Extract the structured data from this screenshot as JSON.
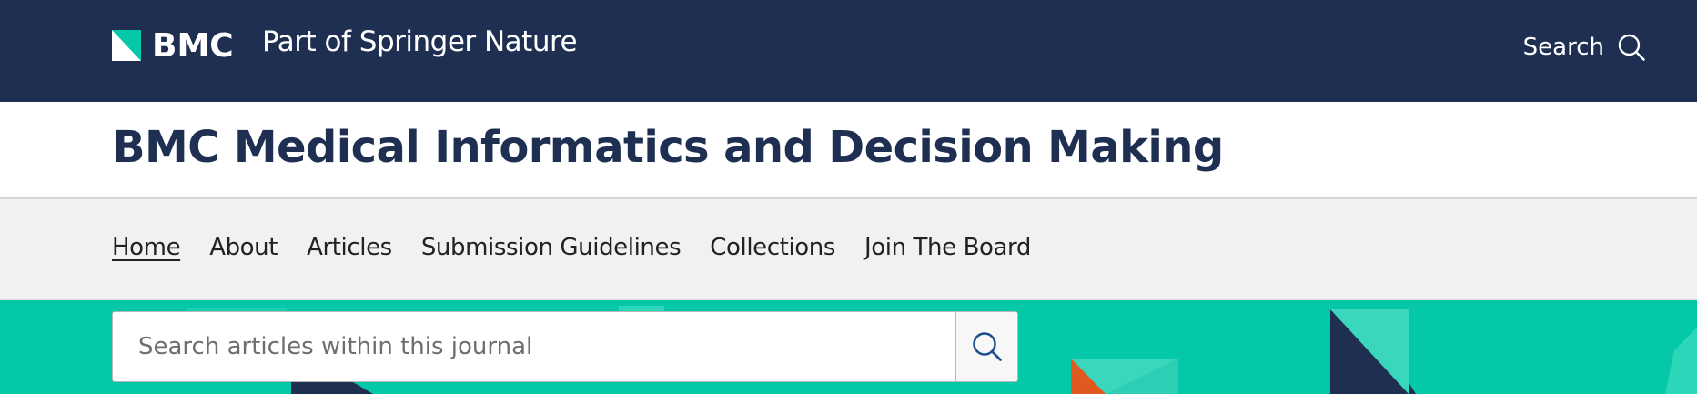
{
  "header": {
    "brand": "BMC",
    "tagline": "Part of Springer Nature",
    "search_label": "Search"
  },
  "journal": {
    "title": "BMC Medical Informatics and Decision Making"
  },
  "nav": {
    "items": [
      {
        "label": "Home",
        "active": true
      },
      {
        "label": "About"
      },
      {
        "label": "Articles"
      },
      {
        "label": "Submission Guidelines"
      },
      {
        "label": "Collections"
      },
      {
        "label": "Join The Board"
      }
    ]
  },
  "search": {
    "placeholder": "Search articles within this journal"
  },
  "icons": {
    "logo": "bmc-logo-mark-icon",
    "top_search": "search-icon",
    "journal_search": "search-icon"
  },
  "colors": {
    "header_bg": "#1e2f51",
    "title_color": "#1e2f51",
    "nav_bg": "#f1f1f1",
    "hero_bg": "#04c8a7",
    "accent_light": "#45d9c0",
    "accent_orange": "#e05a1f",
    "search_icon": "#1e4f8c"
  }
}
